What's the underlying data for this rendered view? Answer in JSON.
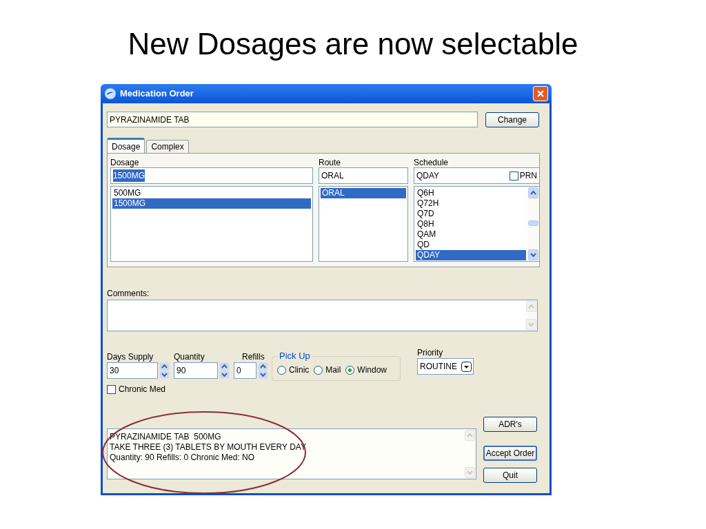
{
  "slide_title": "New Dosages are now selectable",
  "window": {
    "title": "Medication Order"
  },
  "drug": {
    "value": "PYRAZINAMIDE TAB"
  },
  "change_button": "Change",
  "tabs": [
    {
      "label": "Dosage",
      "selected": true
    },
    {
      "label": "Complex",
      "selected": false
    }
  ],
  "dosage": {
    "label": "Dosage",
    "value": "1500MG",
    "value_highlighted": true,
    "options": [
      {
        "label": "500MG",
        "selected": false
      },
      {
        "label": "1500MG",
        "selected": true
      }
    ]
  },
  "route": {
    "label": "Route",
    "value": "ORAL",
    "options": [
      {
        "label": "ORAL",
        "selected": true
      }
    ]
  },
  "schedule": {
    "label": "Schedule",
    "value": "QDAY",
    "prn": {
      "label": "PRN",
      "checked": false
    },
    "options": [
      {
        "label": "Q6H",
        "selected": false
      },
      {
        "label": "Q72H",
        "selected": false
      },
      {
        "label": "Q7D",
        "selected": false
      },
      {
        "label": "Q8H",
        "selected": false
      },
      {
        "label": "QAM",
        "selected": false
      },
      {
        "label": "QD",
        "selected": false
      },
      {
        "label": "QDAY",
        "selected": true
      }
    ]
  },
  "comments": {
    "label": "Comments:"
  },
  "spinners": [
    {
      "label": "Days Supply",
      "value": "30"
    },
    {
      "label": "Quantity",
      "value": "90"
    },
    {
      "label": "Refills",
      "value": "0"
    }
  ],
  "pick_up": {
    "label": "Pick Up",
    "options": [
      {
        "label": "Clinic",
        "selected": false
      },
      {
        "label": "Mail",
        "selected": false
      },
      {
        "label": "Window",
        "selected": true
      }
    ]
  },
  "priority": {
    "label": "Priority",
    "value": "ROUTINE"
  },
  "chronic_med": {
    "label": "Chronic Med",
    "checked": false
  },
  "summary": {
    "lines": [
      "PYRAZINAMIDE TAB  500MG",
      "TAKE THREE (3) TABLETS BY MOUTH EVERY DAY",
      "Quantity: 90 Refills: 0 Chronic Med: NO"
    ]
  },
  "buttons": [
    "ADR's",
    "Accept Order",
    "Quit"
  ]
}
